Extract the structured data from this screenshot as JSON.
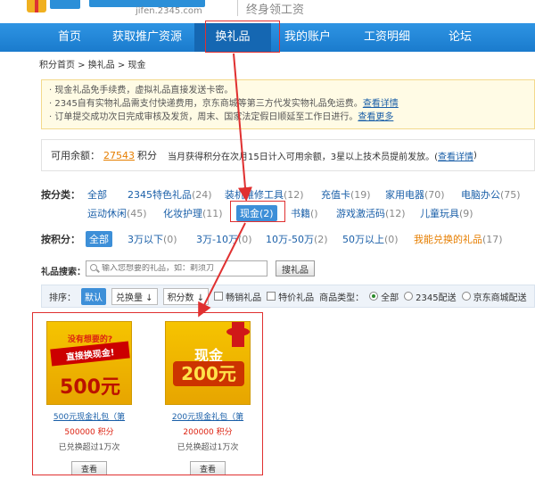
{
  "header": {
    "site_url": "jifen.2345.com",
    "slogan": "终身领工资"
  },
  "nav": {
    "items": [
      {
        "label": "首页"
      },
      {
        "label": "获取推广资源"
      },
      {
        "label": "换礼品"
      },
      {
        "label": "我的账户"
      },
      {
        "label": "工资明细"
      },
      {
        "label": "论坛"
      }
    ]
  },
  "breadcrumb": "积分首页 > 换礼品 > 现金",
  "notice": {
    "line1": "· 现金礼品免手续费，虚拟礼品直接发送卡密。",
    "line2": "· 2345自有实物礼品需支付快递费用，京东商城等第三方代发实物礼品免运费。",
    "line2_link": "查看详情",
    "line3": "· 订单提交成功次日完成审核及发货，周末、国家法定假日顺延至工作日进行。",
    "line3_link": "查看更多"
  },
  "balance": {
    "label": "可用余额：",
    "amount": "27543",
    "unit": "积分",
    "note": "当月获得积分在次月15日计入可用余额，3星以上技术员提前发放。(",
    "link": "查看详情",
    "note_end": ")"
  },
  "category_filter": {
    "label": "按分类：",
    "items": [
      {
        "name": "全部",
        "count": ""
      },
      {
        "name": "2345特色礼品",
        "count": "(24)"
      },
      {
        "name": "装机维修工具",
        "count": "(12)"
      },
      {
        "name": "充值卡",
        "count": "(19)"
      },
      {
        "name": "家用电器",
        "count": "(70)"
      },
      {
        "name": "电脑办公",
        "count": "(75)"
      },
      {
        "name": "运动休闲",
        "count": "(45)"
      },
      {
        "name": "化妆护理",
        "count": "(11)"
      },
      {
        "name": "现金",
        "count": "(2)"
      },
      {
        "name": "书籍",
        "count": "()"
      },
      {
        "name": "游戏激活码",
        "count": "(12)"
      },
      {
        "name": "儿童玩具",
        "count": "(9)"
      }
    ]
  },
  "points_filter": {
    "label": "按积分：",
    "items": [
      {
        "name": "全部",
        "count": ""
      },
      {
        "name": "3万以下",
        "count": "(0)"
      },
      {
        "name": "3万-10万",
        "count": "(0)"
      },
      {
        "name": "10万-50万",
        "count": "(2)"
      },
      {
        "name": "50万以上",
        "count": "(0)"
      },
      {
        "name": "我能兑换的礼品",
        "count": "(17)"
      }
    ]
  },
  "search": {
    "label": "礼品搜索：",
    "placeholder": "输入您想要的礼品，如：剃须刀",
    "button": "搜礼品"
  },
  "sort_bar": {
    "label": "排序：",
    "default": "默认",
    "by_exchange": "兑换量 ↓",
    "by_points": "积分数 ↓",
    "bestseller": "畅销礼品",
    "special": "特价礼品",
    "type_label": "商品类型：",
    "type_all": "全部",
    "type_2345": "2345配送",
    "type_jd": "京东商城配送"
  },
  "products": [
    {
      "img_line1": "没有想要的?",
      "img_line2": "直接换现金!",
      "img_value": "500元",
      "name": "500元现金礼包（第",
      "points": "500000 积分",
      "sold": "已兑换超过1万次",
      "button": "查看"
    },
    {
      "img_line1": "现金",
      "img_value": "200元",
      "name": "200元现金礼包（第",
      "points": "200000 积分",
      "sold": "已兑换超过1万次",
      "button": "查看"
    }
  ],
  "colors": {
    "nav_bg": "#1a7bcd",
    "link": "#1a5fa8",
    "accent_orange": "#e67e00",
    "annotation_red": "#e03030"
  }
}
